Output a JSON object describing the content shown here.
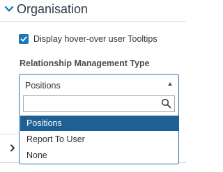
{
  "section": {
    "title": "Organisation",
    "expanded": true,
    "chevron_icon": "chevron-down-icon"
  },
  "tooltips_option": {
    "label": "Display hover-over user Tooltips",
    "checked": true
  },
  "relationship_type": {
    "label": "Relationship Management Type",
    "selected_value": "Positions",
    "dropdown_open": true,
    "search": {
      "value": "",
      "icon": "search-icon"
    },
    "options": [
      {
        "label": "Positions",
        "selected": true
      },
      {
        "label": "Report To User",
        "selected": false
      },
      {
        "label": "None",
        "selected": false
      }
    ]
  },
  "next_section": {
    "expanded": false,
    "chevron_icon": "chevron-right-icon"
  },
  "colors": {
    "accent": "#1f75b8",
    "selected_option_bg": "#1e5f94",
    "heading": "#2f3d4c"
  }
}
